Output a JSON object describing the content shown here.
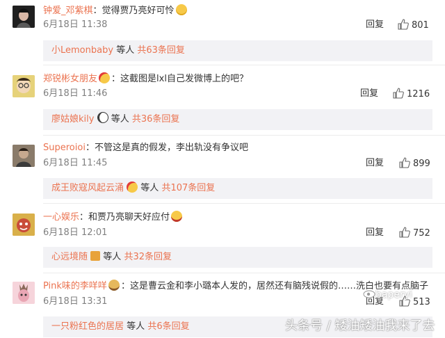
{
  "comments": [
    {
      "username": "钟爱_邓紫棋",
      "text": "觉得贾乃亮好可怜",
      "emoji": "grin-sweat-emoji",
      "date": "6月18日 11:38",
      "reply_label": "回复",
      "likes": "801",
      "sub_name": "小Lemonbaby",
      "sub_word": "等人",
      "sub_count": "共63条回复"
    },
    {
      "username": "郑锐彬女朋友",
      "text": "这截图是lxl自己发微博上的吧？",
      "emoji": "heart-eyes-emoji",
      "date": "6月18日 11:46",
      "reply_label": "回复",
      "likes": "1216",
      "sub_name": "廖姑娘kily",
      "sub_word": "等人",
      "sub_count": "共36条回复"
    },
    {
      "username": "Superoioi",
      "text": "不管这是真的假发，李出轨没有争议吧",
      "emoji": "",
      "date": "6月18日 11:45",
      "reply_label": "回复",
      "likes": "899",
      "sub_name": "成王败寇风起云涌",
      "sub_word": "等人",
      "sub_count": "共107条回复"
    },
    {
      "username": "一心娱乐",
      "text": "和贾乃亮聊天好应付",
      "emoji": "laughing-emoji",
      "date": "6月18日 12:01",
      "reply_label": "回复",
      "likes": "752",
      "sub_name": "心远境随",
      "sub_word": "等人",
      "sub_count": "共32条回复"
    },
    {
      "username": "Pink味的李咩咩",
      "text": "这是曹云金和李小璐本人发的，居然还有脑残说假的……洗白也要有点脑子",
      "emoji": "",
      "date": "6月18日 13:31",
      "reply_label": "回复",
      "likes": "513",
      "sub_name": "一只粉红色的居居",
      "sub_word": "等人",
      "sub_count": "共6条回复"
    }
  ],
  "watermark": {
    "source": "头条号 / 矮油矮油我来了去",
    "handle": "baperyi"
  },
  "colors": {
    "username": "#eb7350",
    "subbox_bg": "#f2f2f5",
    "meta": "#808080"
  }
}
